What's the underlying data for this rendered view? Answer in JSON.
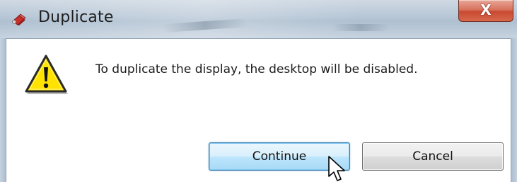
{
  "window": {
    "title": "Duplicate",
    "close_label": "X",
    "app_icon": "red-diamond-app-icon"
  },
  "dialog": {
    "icon": "warning-triangle-icon",
    "message": "To duplicate the display, the desktop will be disabled.",
    "buttons": {
      "continue_label": "Continue",
      "cancel_label": "Cancel"
    },
    "focused_button": "Continue"
  },
  "colors": {
    "titlebar": "#b6c6d6",
    "close_button": "#c84a31",
    "warning_yellow": "#ffe200",
    "focus_border": "#3c7fb1"
  }
}
